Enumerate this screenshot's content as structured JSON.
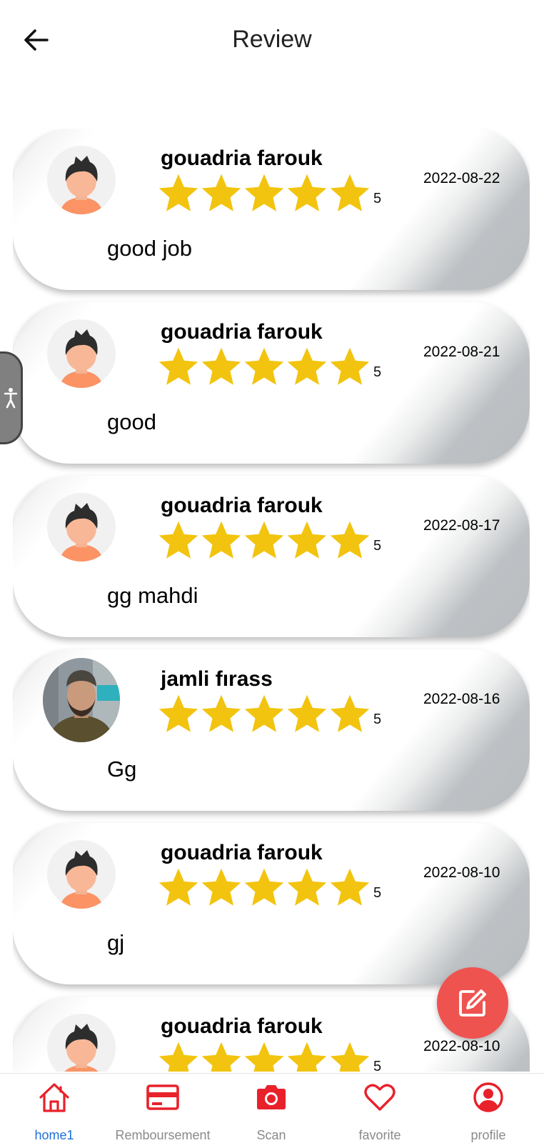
{
  "header": {
    "title": "Review",
    "back_icon": "arrow-left-icon"
  },
  "reviews": [
    {
      "name": "gouadria farouk",
      "rating": 5,
      "rating_label": "5",
      "date": "2022-08-22",
      "comment": "good job",
      "avatar": "default-avatar"
    },
    {
      "name": "gouadria farouk",
      "rating": 5,
      "rating_label": "5",
      "date": "2022-08-21",
      "comment": "good",
      "avatar": "default-avatar"
    },
    {
      "name": "gouadria farouk",
      "rating": 5,
      "rating_label": "5",
      "date": "2022-08-17",
      "comment": "gg mahdi",
      "avatar": "default-avatar"
    },
    {
      "name": "jamli fırass",
      "rating": 5,
      "rating_label": "5",
      "date": "2022-08-16",
      "comment": "Gg",
      "avatar": "user-photo"
    },
    {
      "name": "gouadria farouk",
      "rating": 5,
      "rating_label": "5",
      "date": "2022-08-10",
      "comment": "gj",
      "avatar": "default-avatar"
    },
    {
      "name": "gouadria farouk",
      "rating": 5,
      "rating_label": "5",
      "date": "2022-08-10",
      "comment": "",
      "avatar": "default-avatar"
    }
  ],
  "fab": {
    "icon": "edit-icon"
  },
  "accessibility": {
    "icon": "accessibility-icon"
  },
  "bottom_nav": {
    "items": [
      {
        "label": "home1",
        "icon": "home-icon",
        "active": true
      },
      {
        "label": "Remboursement",
        "icon": "card-icon",
        "active": false
      },
      {
        "label": "Scan",
        "icon": "camera-icon",
        "active": false
      },
      {
        "label": "favorite",
        "icon": "heart-icon",
        "active": false
      },
      {
        "label": "profile",
        "icon": "profile-icon",
        "active": false
      }
    ]
  },
  "colors": {
    "star": "#f2c40f",
    "accent": "#e8212b",
    "fab": "#ef5350",
    "active_label": "#1e6fd9"
  }
}
